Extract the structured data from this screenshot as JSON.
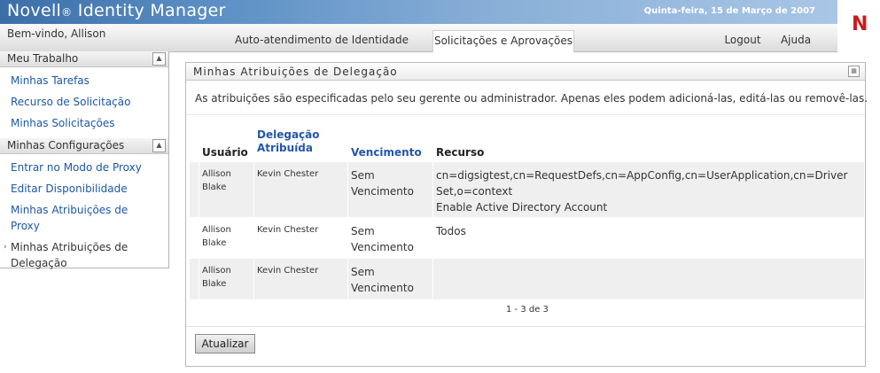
{
  "header": {
    "brand": "Novell",
    "brand_reg": "®",
    "brand_product": " Identity Manager",
    "date": "Quinta-feira, 15 de Março de 2007",
    "logo_letter": "N"
  },
  "navbar": {
    "welcome": "Bem-vindo, Allison",
    "tabs": [
      {
        "label": "Auto-atendimento de Identidade",
        "active": false
      },
      {
        "label": "Solicitações e Aprovações",
        "active": true
      }
    ],
    "logout": "Logout",
    "help": "Ajuda"
  },
  "sidebar": {
    "sections": [
      {
        "title": "Meu Trabalho",
        "items": [
          "Minhas Tarefas",
          "Recurso de Solicitação",
          "Minhas Solicitações"
        ]
      },
      {
        "title": "Minhas Configurações",
        "items": [
          "Entrar no Modo de Proxy",
          "Editar Disponibilidade",
          "Minhas Atribuições de Proxy",
          "Minhas Atribuições de Delegação"
        ],
        "current": "Minhas Atribuições de Delegação"
      }
    ]
  },
  "panel": {
    "title": "Minhas Atribuições de Delegação",
    "description": "As atribuições são especificadas pelo seu gerente ou administrador. Apenas eles podem adicioná-las, editá-las ou removê-las.",
    "columns": {
      "user": "Usuário",
      "delegate": "Delegação Atribuída",
      "expiration": "Vencimento",
      "resource": "Recurso"
    },
    "rows": [
      {
        "user": "Allison Blake",
        "delegate": "Kevin Chester",
        "expiration": "Sem Vencimento",
        "resource": "cn=digsigtest,cn=RequestDefs,cn=AppConfig,cn=UserApplication,cn=Driver Set,o=context",
        "resource_name": "Enable Active Directory Account"
      },
      {
        "user": "Allison Blake",
        "delegate": "Kevin Chester",
        "expiration": "Sem Vencimento",
        "resource": "Todos",
        "resource_name": ""
      },
      {
        "user": "Allison Blake",
        "delegate": "Kevin Chester",
        "expiration": "Sem Vencimento",
        "resource": "",
        "resource_name": ""
      }
    ],
    "pager": "1 - 3 de 3",
    "refresh_label": "Atualizar"
  },
  "colors": {
    "link": "#1c57a5",
    "banner": "#3b6ea7",
    "logo": "#cc1b1b"
  }
}
